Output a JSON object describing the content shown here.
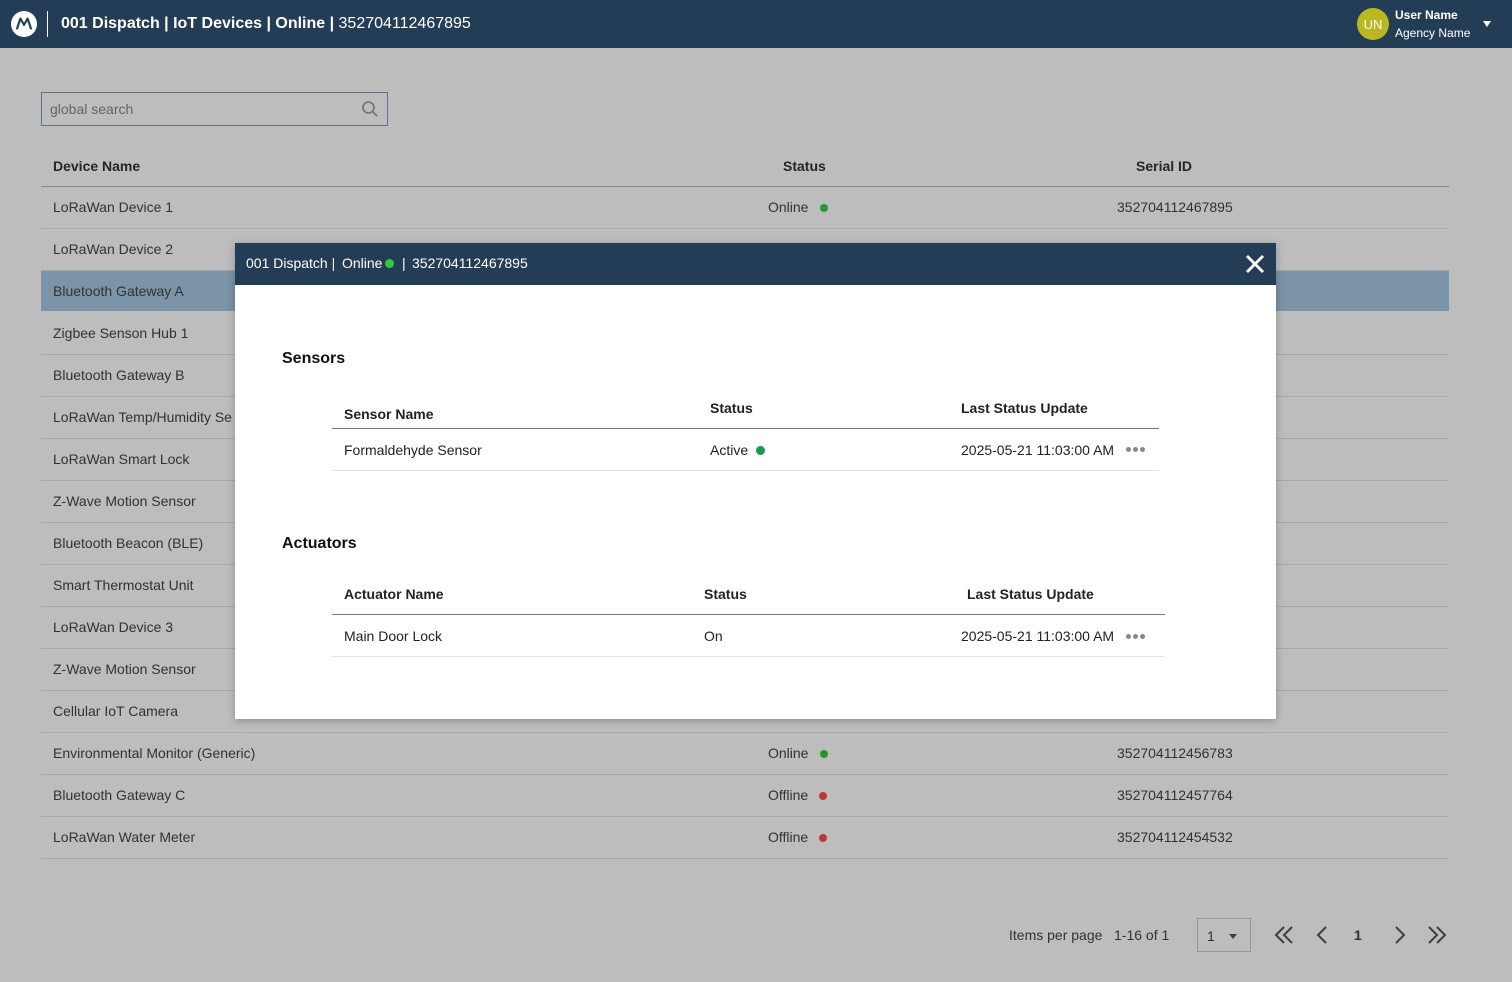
{
  "header": {
    "title_bold": "001 Dispatch | IoT Devices | Online |",
    "title_id": "352704112467895",
    "avatar_initials": "UN",
    "user_name": "User Name",
    "agency_name": "Agency Name"
  },
  "search": {
    "placeholder": "global search"
  },
  "device_table": {
    "columns": [
      "Device Name",
      "Status",
      "Serial ID"
    ],
    "rows": [
      {
        "name": "LoRaWan Device 1",
        "status": "Online",
        "serial": "352704112467895"
      },
      {
        "name": "LoRaWan Device 2",
        "status": "",
        "serial": ""
      },
      {
        "name": "Bluetooth Gateway A",
        "status": "",
        "serial": ""
      },
      {
        "name": "Zigbee Senson Hub 1",
        "status": "",
        "serial": ""
      },
      {
        "name": "Bluetooth Gateway B",
        "status": "",
        "serial": ""
      },
      {
        "name": "LoRaWan Temp/Humidity Se",
        "status": "",
        "serial": ""
      },
      {
        "name": "LoRaWan Smart Lock",
        "status": "",
        "serial": ""
      },
      {
        "name": "Z-Wave Motion Sensor",
        "status": "",
        "serial": ""
      },
      {
        "name": "Bluetooth Beacon (BLE)",
        "status": "",
        "serial": ""
      },
      {
        "name": "Smart Thermostat Unit",
        "status": "",
        "serial": ""
      },
      {
        "name": "LoRaWan Device 3",
        "status": "",
        "serial": ""
      },
      {
        "name": "Z-Wave Motion Sensor",
        "status": "",
        "serial": ""
      },
      {
        "name": "Cellular IoT Camera",
        "status": "",
        "serial": ""
      },
      {
        "name": "Environmental Monitor (Generic)",
        "status": "Online",
        "serial": "352704112456783"
      },
      {
        "name": "Bluetooth Gateway C",
        "status": "Offline",
        "serial": "352704112457764"
      },
      {
        "name": "LoRaWan Water Meter",
        "status": "Offline",
        "serial": "352704112454532"
      }
    ]
  },
  "pagination": {
    "items_per_page_label": "Items per page",
    "range": "1-16 of 1",
    "per_page_value": "1",
    "current_page": "1"
  },
  "modal": {
    "head_prefix": "001 Dispatch |",
    "head_status": "Online",
    "head_sep": "|",
    "head_serial": "352704112467895",
    "sensors": {
      "title": "Sensors",
      "columns": [
        "Sensor Name",
        "Status",
        "Last Status Update"
      ],
      "rows": [
        {
          "name": "Formaldehyde Sensor",
          "status": "Active",
          "updated": "2025-05-21 11:03:00 AM"
        }
      ]
    },
    "actuators": {
      "title": "Actuators",
      "columns": [
        "Actuator Name",
        "Status",
        "Last Status Update"
      ],
      "rows": [
        {
          "name": "Main Door Lock",
          "status": "On",
          "updated": "2025-05-21 11:03:00 AM"
        }
      ]
    }
  },
  "colors": {
    "header_bg": "#243d57",
    "online": "#2ecc40",
    "offline": "#ff4d4d",
    "active": "#1a9a4a",
    "selected_row": "#a8c8e3"
  }
}
